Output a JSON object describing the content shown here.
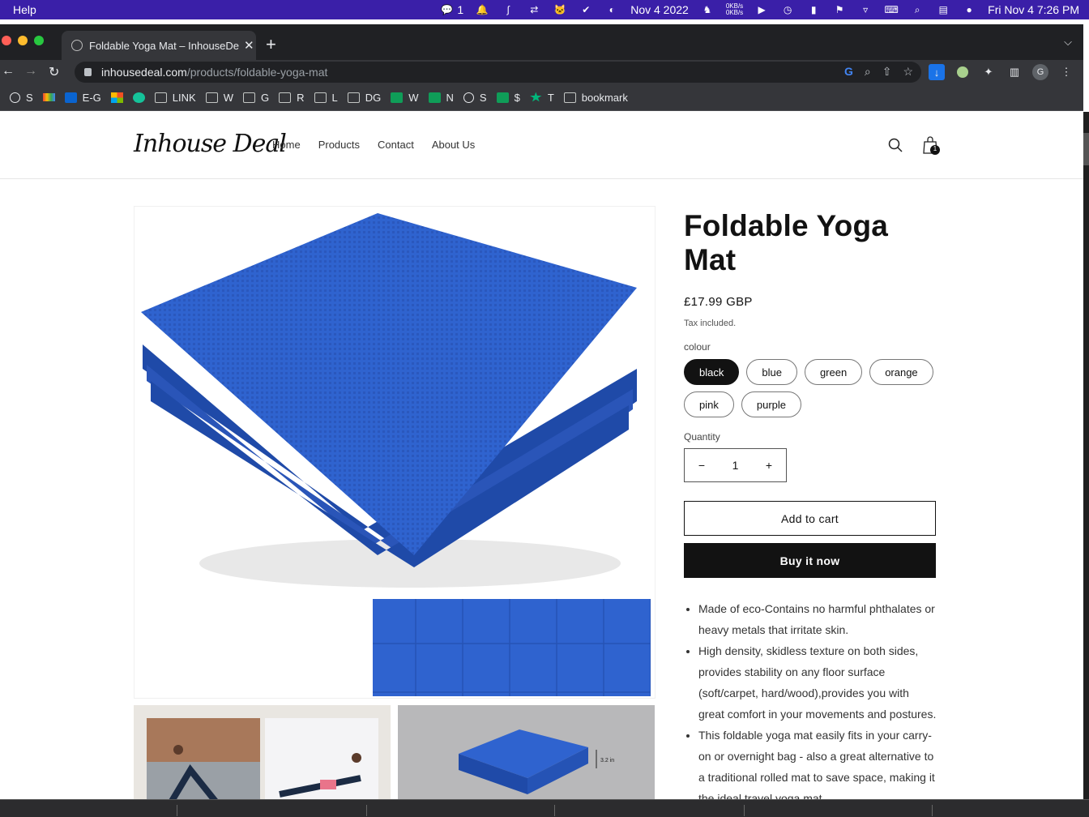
{
  "menubar": {
    "app_menu": "Help",
    "wechat_count": "1",
    "date": "Nov 4 2022",
    "net_up": "0KB/s",
    "net_down": "0KB/s",
    "clock": "Fri Nov 4  7:26 PM"
  },
  "browser": {
    "tab_title": "Foldable Yoga Mat – InhouseDeal",
    "url_host": "inhousedeal.com",
    "url_path": "/products/foldable-yoga-mat",
    "profile_initial": "G",
    "bookmarks": [
      {
        "label": "S",
        "icon": "globe-icon"
      },
      {
        "label": "",
        "icon": "gmail-icon"
      },
      {
        "label": "E-G",
        "icon": "outlook-icon"
      },
      {
        "label": "",
        "icon": "microsoft-icon"
      },
      {
        "label": "",
        "icon": "grammarly-icon"
      },
      {
        "label": "LINK",
        "icon": "folder-icon"
      },
      {
        "label": "W",
        "icon": "folder-icon"
      },
      {
        "label": "G",
        "icon": "folder-icon"
      },
      {
        "label": "R",
        "icon": "folder-icon"
      },
      {
        "label": "L",
        "icon": "folder-icon"
      },
      {
        "label": "DG",
        "icon": "folder-icon"
      },
      {
        "label": "W",
        "icon": "sheets-icon"
      },
      {
        "label": "N",
        "icon": "sheets-icon"
      },
      {
        "label": "S",
        "icon": "globe-icon"
      },
      {
        "label": "$",
        "icon": "sheets-icon"
      },
      {
        "label": "T",
        "icon": "star-icon"
      },
      {
        "label": "bookmark",
        "icon": "folder-icon"
      }
    ]
  },
  "site": {
    "logo": "Inhouse Deal",
    "nav": [
      "Home",
      "Products",
      "Contact",
      "About Us"
    ],
    "cart_count": "1"
  },
  "product": {
    "title": "Foldable Yoga Mat",
    "price": "£17.99 GBP",
    "tax_note": "Tax included.",
    "option_label": "colour",
    "colours": [
      "black",
      "blue",
      "green",
      "orange",
      "pink",
      "purple"
    ],
    "selected_colour": "black",
    "quantity_label": "Quantity",
    "quantity": "1",
    "add_to_cart": "Add to cart",
    "buy_now": "Buy it now",
    "thickness_label": "3.2 in",
    "description": [
      "Made of eco-Contains no harmful phthalates or heavy metals that irritate skin.",
      "High density, skidless texture on both sides, provides stability on any floor surface (soft/carpet, hard/wood),provides you with great comfort in your movements and postures.",
      "This foldable yoga mat easily fits in your carry-on or overnight bag - also a great alternative to a traditional rolled mat to save space, making it the ideal travel yoga mat."
    ]
  },
  "colors": {
    "menubar_bg": "#3a1fa8",
    "chrome_dark": "#202124",
    "chrome_toolbar": "#35363a",
    "mat_blue": "#2f63cf",
    "button_dark": "#121212"
  }
}
